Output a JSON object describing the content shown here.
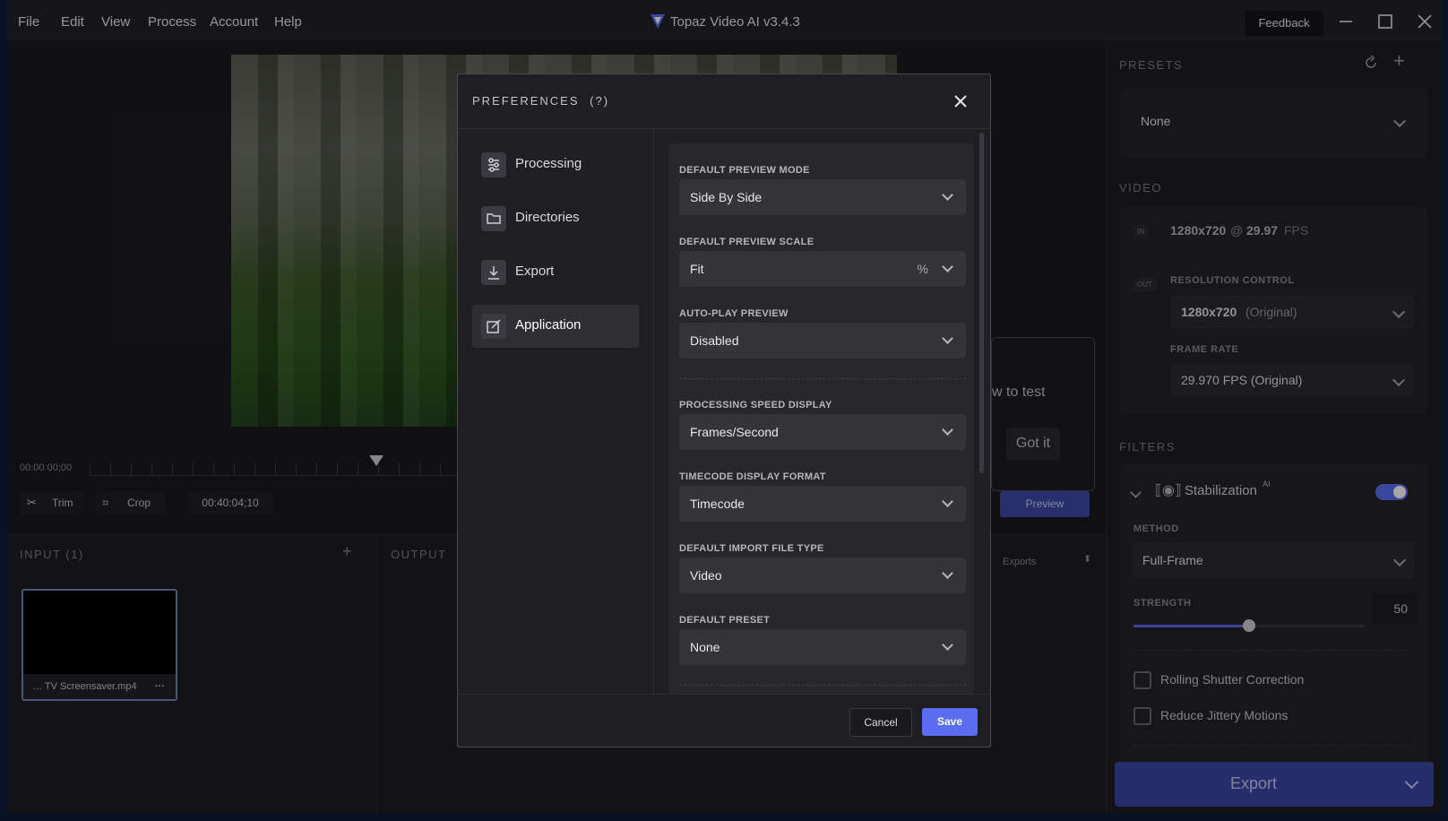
{
  "titlebar": {
    "menu": [
      "File",
      "Edit",
      "View",
      "Process",
      "Account",
      "Help"
    ],
    "app_title": "Topaz Video AI  v3.4.3",
    "feedback": "Feedback"
  },
  "timeline": {
    "start_time": "00:00:00;00",
    "trim": "Trim",
    "crop": "Crop",
    "duration": "00:40:04;10"
  },
  "input_panel": {
    "label": "INPUT (1)",
    "file_name": "… TV Screensaver.mp4"
  },
  "output_panel": {
    "label": "OUTPUT",
    "exports": "Exports"
  },
  "tooltip": {
    "text": "w to test",
    "got_it": "Got it",
    "preview": "Preview"
  },
  "right_panel": {
    "presets_label": "PRESETS",
    "preset_value": "None",
    "video_label": "VIDEO",
    "in_tag": "IN",
    "in_resolution": "1280x720",
    "in_at": "@",
    "in_fps_value": "29.97",
    "in_fps_unit": "FPS",
    "out_tag": "OUT",
    "resolution_control_label": "RESOLUTION CONTROL",
    "resolution_value": "1280x720",
    "resolution_note": "(Original)",
    "frame_rate_label": "FRAME RATE",
    "frame_rate_value": "29.970 FPS (Original)",
    "filters_label": "FILTERS",
    "stabilization": "Stabilization",
    "ai_tag": "AI",
    "method_label": "METHOD",
    "method_value": "Full-Frame",
    "strength_label": "STRENGTH",
    "strength_value": "50",
    "rolling_shutter": "Rolling Shutter Correction",
    "reduce_jittery": "Reduce Jittery Motions",
    "export": "Export"
  },
  "preferences": {
    "title": "PREFERENCES",
    "help": "(?)",
    "sidebar": [
      {
        "label": "Processing",
        "icon": "sliders-icon"
      },
      {
        "label": "Directories",
        "icon": "folder-icon"
      },
      {
        "label": "Export",
        "icon": "download-icon"
      },
      {
        "label": "Application",
        "icon": "edit-icon"
      }
    ],
    "fields": {
      "preview_mode": {
        "label": "DEFAULT PREVIEW MODE",
        "value": "Side By Side"
      },
      "preview_scale": {
        "label": "DEFAULT PREVIEW SCALE",
        "value": "Fit",
        "unit": "%"
      },
      "auto_play": {
        "label": "AUTO-PLAY PREVIEW",
        "value": "Disabled"
      },
      "speed_display": {
        "label": "PROCESSING SPEED DISPLAY",
        "value": "Frames/Second"
      },
      "timecode_format": {
        "label": "TIMECODE DISPLAY FORMAT",
        "value": "Timecode"
      },
      "import_type": {
        "label": "DEFAULT IMPORT FILE TYPE",
        "value": "Video"
      },
      "default_preset": {
        "label": "DEFAULT PRESET",
        "value": "None"
      }
    },
    "cancel": "Cancel",
    "save": "Save"
  },
  "colors": {
    "accent": "#5b6df0",
    "export_button": "#3a46a3",
    "background": "#1b1b1e"
  }
}
